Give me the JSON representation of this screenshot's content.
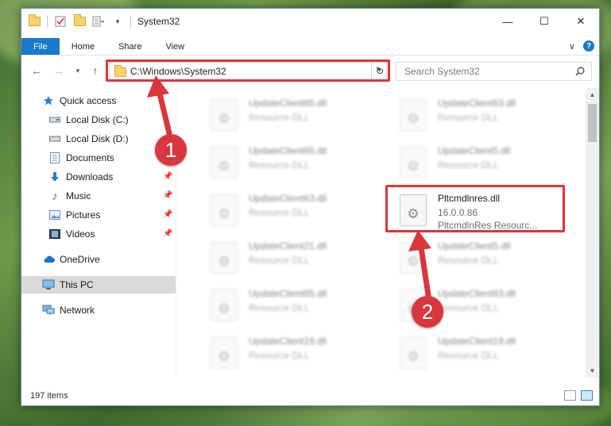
{
  "window": {
    "title": "System32"
  },
  "titlebar": {
    "quick_access_icons": [
      "folder-icon",
      "properties-icon",
      "new-folder-icon",
      "customize-icon"
    ],
    "buttons": {
      "minimize": "—",
      "maximize": "☐",
      "close": "✕"
    }
  },
  "ribbon": {
    "tabs": [
      "File",
      "Home",
      "Share",
      "View"
    ],
    "expand": "∨",
    "help": "?"
  },
  "address": {
    "path": "C:\\Windows\\System32",
    "refresh": "↻"
  },
  "search": {
    "placeholder": "Search System32"
  },
  "nav": {
    "items": [
      {
        "label": "Quick access",
        "icon": "star-icon",
        "pinned": false
      },
      {
        "label": "Local Disk (C:)",
        "icon": "drive-icon",
        "pinned": false
      },
      {
        "label": "Local Disk (D:)",
        "icon": "drive-icon",
        "pinned": false
      },
      {
        "label": "Documents",
        "icon": "document-icon",
        "pinned": true
      },
      {
        "label": "Downloads",
        "icon": "download-icon",
        "pinned": true
      },
      {
        "label": "Music",
        "icon": "music-icon",
        "pinned": true
      },
      {
        "label": "Pictures",
        "icon": "pictures-icon",
        "pinned": true
      },
      {
        "label": "Videos",
        "icon": "videos-icon",
        "pinned": true
      },
      {
        "label": "OneDrive",
        "icon": "cloud-icon",
        "pinned": false
      },
      {
        "label": "This PC",
        "icon": "computer-icon",
        "pinned": false,
        "selected": true
      },
      {
        "label": "Network",
        "icon": "network-icon",
        "pinned": false
      }
    ]
  },
  "files": [
    {
      "name": "UpdateClient65.dll",
      "line2": "Resource DLL",
      "line3": "",
      "blurred": true
    },
    {
      "name": "UpdateClient63.dll",
      "line2": "Resource DLL",
      "line3": "",
      "blurred": true
    },
    {
      "name": "UpdateClient65.dll",
      "line2": "Resource DLL",
      "line3": "",
      "blurred": true
    },
    {
      "name": "UpdateClient5.dll",
      "line2": "Resource DLL",
      "line3": "",
      "blurred": true
    },
    {
      "name": "UpdateClient63.dll",
      "line2": "Resource DLL",
      "line3": "",
      "blurred": true
    },
    {
      "name": "Pltcmdlnres.dll",
      "line2": "16.0.0.86",
      "line3": "PltcmdlnRes Resourc...",
      "blurred": false
    },
    {
      "name": "UpdateClient21.dll",
      "line2": "Resource DLL",
      "line3": "",
      "blurred": true
    },
    {
      "name": "UpdateClient5.dll",
      "line2": "Resource DLL",
      "line3": "",
      "blurred": true
    },
    {
      "name": "UpdateClient65.dll",
      "line2": "Resource DLL",
      "line3": "",
      "blurred": true
    },
    {
      "name": "UpdateClient63.dll",
      "line2": "Resource DLL",
      "line3": "",
      "blurred": true
    },
    {
      "name": "UpdateClient19.dll",
      "line2": "Resource DLL",
      "line3": "",
      "blurred": true
    },
    {
      "name": "UpdateClient19.dll",
      "line2": "Resource DLL",
      "line3": "",
      "blurred": true
    }
  ],
  "status": {
    "item_count": "197 items"
  },
  "annotations": {
    "callout1": "1",
    "callout2": "2",
    "highlight_color": "#d9363e"
  }
}
